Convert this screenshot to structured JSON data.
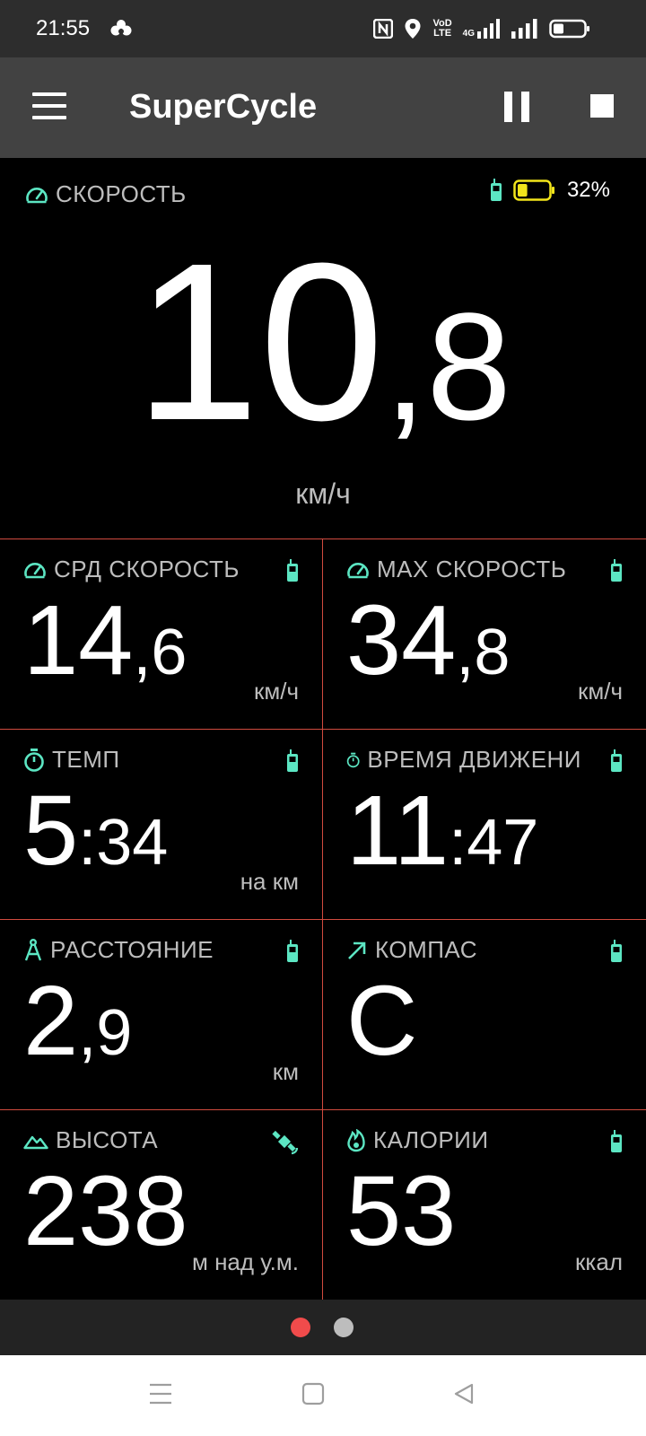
{
  "status_bar": {
    "time": "21:55",
    "net_top": "VoD",
    "net_bottom": "LTE",
    "net_type": "4G",
    "icons": [
      "app-notification-icon",
      "nfc-icon",
      "location-icon",
      "volte-icon",
      "signal-4g-icon",
      "signal-icon",
      "battery-icon"
    ]
  },
  "app_bar": {
    "title": "SuperCycle",
    "icons": [
      "menu-icon",
      "pause-icon",
      "stop-icon"
    ]
  },
  "speed": {
    "label": "СКОРОСТЬ",
    "int": "10",
    "sep": ",",
    "dec": "8",
    "unit": "км/ч",
    "battery_pct": "32%",
    "battery_level": 0.32,
    "accent": "#5ce6c3",
    "battery_color": "#f2e51b"
  },
  "tiles": [
    {
      "label": "СРД СКОРОСТЬ",
      "int": "14",
      "sep": ",",
      "small": "6",
      "unit": "км/ч",
      "icon": "speedometer-icon",
      "source_icon": "phone-icon"
    },
    {
      "label": "МАХ СКОРОСТЬ",
      "int": "34",
      "sep": ",",
      "small": "8",
      "unit": "км/ч",
      "icon": "speedometer-icon",
      "source_icon": "phone-icon"
    },
    {
      "label": "ТЕМП",
      "int": "5",
      "sep": ":",
      "small": "34",
      "unit": "на км",
      "icon": "stopwatch-icon",
      "source_icon": "phone-icon"
    },
    {
      "label": "ВРЕМЯ ДВИЖЕНИ",
      "int": "11",
      "sep": ":",
      "small": "47",
      "unit": "",
      "icon": "stopwatch-icon",
      "source_icon": "phone-icon"
    },
    {
      "label": "РАССТОЯНИЕ",
      "int": "2",
      "sep": ",",
      "small": "9",
      "unit": "км",
      "icon": "compass-divider-icon",
      "source_icon": "phone-icon"
    },
    {
      "label": "КОМПАС",
      "int": "С",
      "sep": "",
      "small": "",
      "unit": "",
      "icon": "arrow-northeast-icon",
      "source_icon": "phone-icon"
    },
    {
      "label": "ВЫСОТА",
      "int": "238",
      "sep": "",
      "small": "",
      "unit": "м над у.м.",
      "icon": "mountain-icon",
      "source_icon": "satellite-icon"
    },
    {
      "label": "КАЛОРИИ",
      "int": "53",
      "sep": "",
      "small": "",
      "unit": "ккал",
      "icon": "flame-icon",
      "source_icon": "phone-icon"
    }
  ],
  "pager": {
    "pages": 2,
    "active": 1,
    "active_color": "#f04b4b",
    "inactive_color": "#bdbdbd"
  },
  "nav_bar": {
    "icons": [
      "recent-apps-icon",
      "home-icon",
      "back-icon"
    ]
  },
  "colors": {
    "grid_line": "#d14b3f",
    "label_text": "#bdbdbd",
    "status_bg": "#2d2d2d",
    "appbar_bg": "#424242"
  }
}
